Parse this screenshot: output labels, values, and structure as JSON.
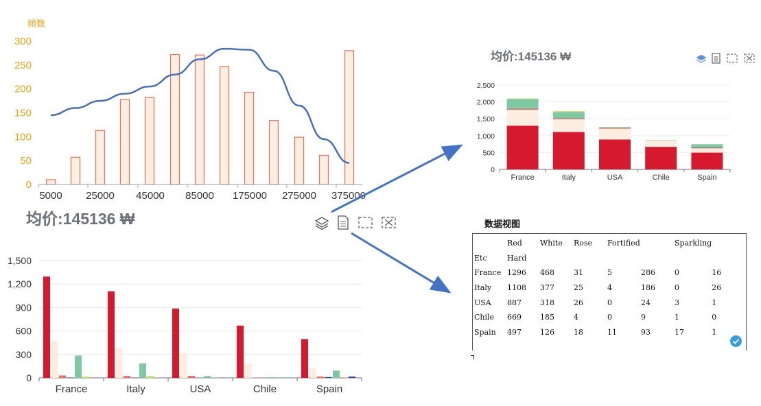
{
  "colors": {
    "axis_text_yellow": "#e8a317",
    "bar_fill": "#fdeee3",
    "bar_stroke": "#e07a5f",
    "curve": "#4a6fb5",
    "arrow": "#4472c4",
    "title_gray": "#6e7079",
    "red": "#d7192f",
    "cream": "#fbeee0",
    "salmon": "#e8736b",
    "teal": "#7ec8a3",
    "yellowgreen": "#c8e06a",
    "navy": "#2e4a8a"
  },
  "price_title": "均价:145136 ₩",
  "chart_data": [
    {
      "type": "bar",
      "name": "histogram",
      "ylabel": "频数",
      "ylim": [
        0,
        300
      ],
      "yticks": [
        0,
        50,
        100,
        150,
        200,
        250,
        300
      ],
      "xtick_labels": [
        "5000",
        "25000",
        "45000",
        "85000",
        "175000",
        "275000",
        "375000"
      ],
      "values": [
        10,
        57,
        113,
        178,
        182,
        272,
        271,
        247,
        193,
        134,
        99,
        61,
        280
      ],
      "curve": [
        145,
        160,
        175,
        190,
        205,
        230,
        262,
        284,
        282,
        238,
        165,
        95,
        45
      ]
    },
    {
      "type": "bar",
      "name": "grouped",
      "categories": [
        "France",
        "Italy",
        "USA",
        "Chile",
        "Spain"
      ],
      "ylim": [
        0,
        1500
      ],
      "ytick_labels": [
        "0",
        "300",
        "600",
        "900",
        "1,200",
        "1,500"
      ],
      "series": [
        {
          "color": "red",
          "values": [
            1296,
            1108,
            887,
            669,
            497
          ]
        },
        {
          "color": "cream",
          "values": [
            468,
            377,
            318,
            185,
            126
          ]
        },
        {
          "color": "salmon",
          "values": [
            31,
            25,
            26,
            4,
            18
          ]
        },
        {
          "color": "navy",
          "values": [
            5,
            4,
            0,
            0,
            11
          ]
        },
        {
          "color": "teal",
          "values": [
            286,
            186,
            24,
            9,
            93
          ]
        },
        {
          "color": "yellowgreen",
          "values": [
            16,
            26,
            1,
            0,
            1
          ]
        },
        {
          "color": "navy",
          "values": [
            0,
            0,
            3,
            1,
            17
          ]
        }
      ]
    },
    {
      "type": "bar",
      "name": "stacked",
      "categories": [
        "France",
        "Italy",
        "USA",
        "Chile",
        "Spain"
      ],
      "ylim": [
        0,
        2500
      ],
      "ytick_labels": [
        "0",
        "500",
        "1,000",
        "1,500",
        "2,000",
        "2,500"
      ],
      "series": [
        {
          "color": "red",
          "values": [
            1296,
            1108,
            887,
            669,
            497
          ]
        },
        {
          "color": "cream",
          "values": [
            468,
            377,
            318,
            185,
            126
          ]
        },
        {
          "color": "salmon",
          "values": [
            31,
            25,
            26,
            4,
            18
          ]
        },
        {
          "color": "navy",
          "values": [
            5,
            4,
            0,
            0,
            11
          ]
        },
        {
          "color": "teal",
          "values": [
            286,
            186,
            24,
            9,
            93
          ]
        },
        {
          "color": "yellowgreen",
          "values": [
            16,
            26,
            1,
            0,
            1
          ]
        }
      ]
    }
  ],
  "dataview": {
    "title": "数据视图",
    "header": [
      "",
      "Red",
      "White",
      "Rose",
      "Fortified",
      "",
      "Sparkling",
      ""
    ],
    "header2": [
      "Etc",
      "Hard",
      "",
      "",
      "",
      "",
      "",
      ""
    ],
    "rows": [
      [
        "France",
        "1296",
        "468",
        "31",
        "5",
        "286",
        "0",
        "16"
      ],
      [
        "Italy",
        "1108",
        "377",
        "25",
        "4",
        "186",
        "0",
        "26"
      ],
      [
        "USA",
        "887",
        "318",
        "26",
        "0",
        "24",
        "3",
        "1"
      ],
      [
        "Chile",
        "669",
        "185",
        "4",
        "0",
        "9",
        "1",
        "0"
      ],
      [
        "Spain",
        "497",
        "126",
        "18",
        "11",
        "93",
        "17",
        "1"
      ]
    ]
  },
  "toolbar_icons": [
    "layers-icon",
    "document-icon",
    "zoom-select-icon",
    "zoom-reset-icon"
  ]
}
